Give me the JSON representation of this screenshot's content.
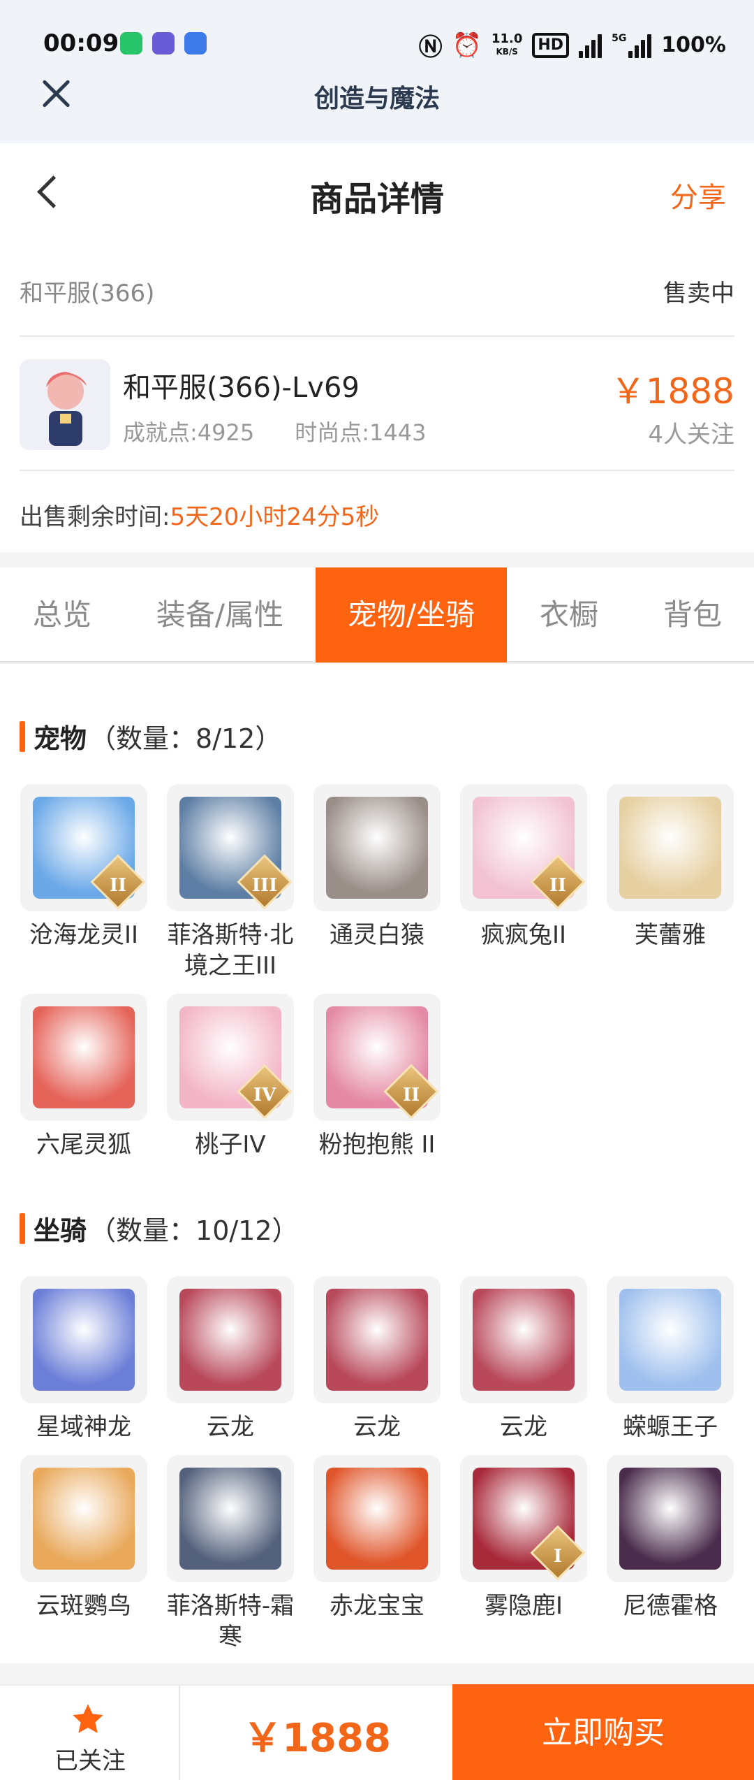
{
  "status_bar": {
    "time": "00:09",
    "net_speed_value": "11.0",
    "net_speed_unit": "KB/S",
    "hd_label": "HD",
    "signal_label": "5G",
    "battery": "100%"
  },
  "app_bar": {
    "title": "创造与魔法"
  },
  "header": {
    "title": "商品详情",
    "share_label": "分享"
  },
  "listing": {
    "server": "和平服(366)",
    "status": "售卖中",
    "name": "和平服(366)-Lv69",
    "achievement": "成就点:4925",
    "fashion": "时尚点:1443",
    "price": "￥1888",
    "followers": "4人关注",
    "time_left_label": "出售剩余时间:",
    "time_left_value": "5天20小时24分5秒"
  },
  "tabs": [
    "总览",
    "装备/属性",
    "宠物/坐骑",
    "衣橱",
    "背包"
  ],
  "active_tab": 2,
  "pets": {
    "title": "宠物",
    "count": "（数量：8/12）",
    "items": [
      {
        "name": "沧海龙灵II",
        "rank": "II",
        "color": "#6aa8e8"
      },
      {
        "name": "菲洛斯特·北境之王III",
        "rank": "III",
        "color": "#5d7ea4"
      },
      {
        "name": "通灵白猿",
        "rank": "",
        "color": "#9a8e88"
      },
      {
        "name": "疯疯兔II",
        "rank": "II",
        "color": "#f2c2d2"
      },
      {
        "name": "芙蕾雅",
        "rank": "",
        "color": "#e6cfa0"
      },
      {
        "name": "六尾灵狐",
        "rank": "",
        "color": "#e5645a"
      },
      {
        "name": "桃子IV",
        "rank": "IV",
        "color": "#f3b6c8"
      },
      {
        "name": "粉抱抱熊 II",
        "rank": "II",
        "color": "#e58aa6"
      }
    ]
  },
  "mounts": {
    "title": "坐骑",
    "count": "（数量：10/12）",
    "items": [
      {
        "name": "星域神龙",
        "rank": "",
        "color": "#6c7fd8"
      },
      {
        "name": "云龙",
        "rank": "",
        "color": "#b8485a"
      },
      {
        "name": "云龙",
        "rank": "",
        "color": "#b8485a"
      },
      {
        "name": "云龙",
        "rank": "",
        "color": "#b8485a"
      },
      {
        "name": "蝾螈王子",
        "rank": "",
        "color": "#9fc0ee"
      },
      {
        "name": "云斑鹦鸟",
        "rank": "",
        "color": "#e9a85a"
      },
      {
        "name": "菲洛斯特-霜寒",
        "rank": "",
        "color": "#54617c"
      },
      {
        "name": "赤龙宝宝",
        "rank": "",
        "color": "#e0552a"
      },
      {
        "name": "雾隐鹿I",
        "rank": "I",
        "color": "#a8293a"
      },
      {
        "name": "尼德霍格",
        "rank": "",
        "color": "#4a2c4c"
      }
    ]
  },
  "footer": {
    "follow_label": "已关注",
    "price": "￥1888",
    "buy_label": "立即购买"
  }
}
